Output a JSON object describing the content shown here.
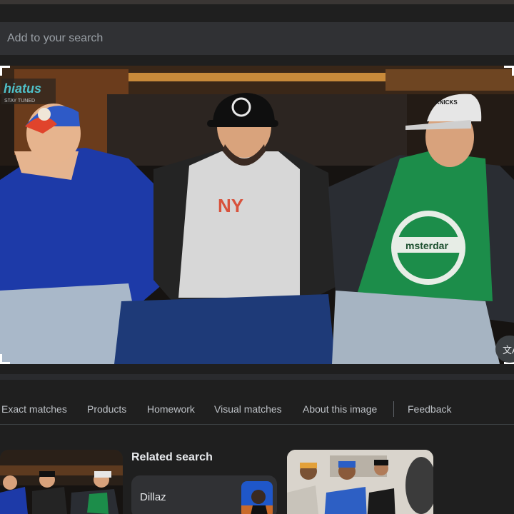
{
  "search": {
    "placeholder": "Add to your search",
    "value": ""
  },
  "image": {
    "watermark_logo": "hiatus",
    "watermark_tagline": "STAY TUNED",
    "shirt_text": "NY",
    "tshirt_text": "msterdar",
    "cap_text": "KNICKS"
  },
  "translate": {
    "label": "文A"
  },
  "tabs": [
    {
      "label": "Exact matches"
    },
    {
      "label": "Products"
    },
    {
      "label": "Homework"
    },
    {
      "label": "Visual matches"
    },
    {
      "label": "About this image"
    },
    {
      "label": "Feedback"
    }
  ],
  "related": {
    "title": "Related search",
    "chip_label": "Dillaz"
  },
  "colors": {
    "background": "#1f1f1f",
    "search_bar": "#303134",
    "text": "#e3e3e3",
    "muted_text": "#bdc1c6"
  }
}
